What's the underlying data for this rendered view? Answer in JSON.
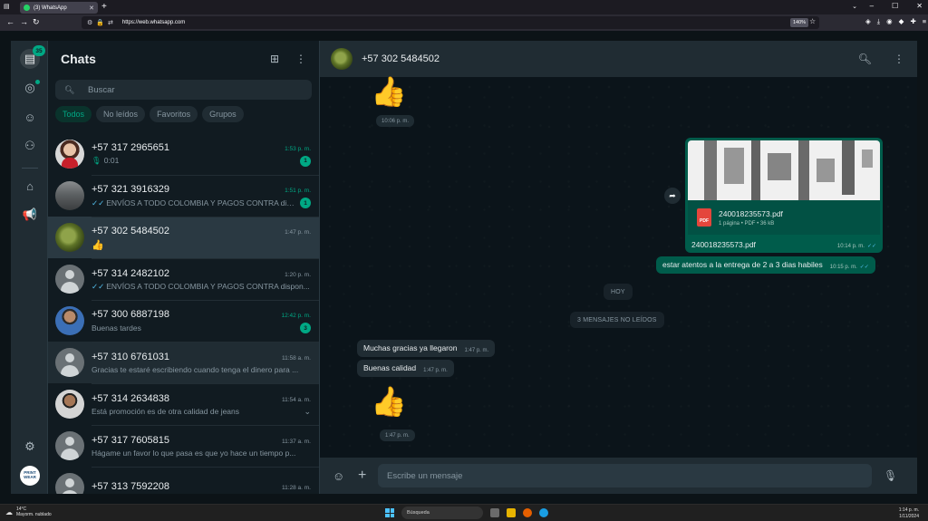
{
  "browser": {
    "tab_title": "(3) WhatsApp",
    "url": "https://web.whatsapp.com",
    "zoom": "140%"
  },
  "rail": {
    "chats_badge": "35",
    "avatar_text": "PRINT WEAR"
  },
  "sidebar": {
    "title": "Chats",
    "search_placeholder": "Buscar",
    "filters": [
      "Todos",
      "No leídos",
      "Favoritos",
      "Grupos"
    ],
    "chats": [
      {
        "name": "+57 317 2965651",
        "time": "1:53 p. m.",
        "preview": "0:01",
        "unread": "1"
      },
      {
        "name": "+57 321 3916329",
        "time": "1:51 p. m.",
        "preview": "ENVÍOS A TODO COLOMBIA Y PAGOS CONTRA dis...",
        "unread": "1"
      },
      {
        "name": "+57 302 5484502",
        "time": "1:47 p. m.",
        "preview": "👍"
      },
      {
        "name": "+57 314 2482102",
        "time": "1:20 p. m.",
        "preview": "ENVÍOS A TODO COLOMBIA Y PAGOS CONTRA dispon..."
      },
      {
        "name": "+57 300 6887198",
        "time": "12:42 p. m.",
        "preview": "Buenas tardes",
        "unread": "3"
      },
      {
        "name": "+57 310 6761031",
        "time": "11:58 a. m.",
        "preview": "Gracias te estaré escribiendo cuando tenga el dinero para ..."
      },
      {
        "name": "+57 314 2634838",
        "time": "11:54 a. m.",
        "preview": "Está promoción es de otra calidad de jeans"
      },
      {
        "name": "+57 317 7605815",
        "time": "11:37 a. m.",
        "preview": "Hágame un favor lo que pasa es que yo hace un tiempo p..."
      },
      {
        "name": "+57 313 7592208",
        "time": "11:28 a. m.",
        "preview": ""
      }
    ]
  },
  "conversation": {
    "contact_name": "+57 302 5484502",
    "emoji_top": "👍",
    "time_top": "10:06 p. m.",
    "document": {
      "file_name": "240018235573.pdf",
      "meta": "1 página • PDF • 36 kB",
      "pdf_label": "PDF",
      "caption": "240018235573.pdf",
      "time": "10:14 p. m."
    },
    "out_msg": {
      "text": "estar atentos a la entrega de 2 a 3 dias habiles",
      "time": "10:15 p. m."
    },
    "day_label": "HOY",
    "unread_label": "3 MENSAJES NO LEÍDOS",
    "in_msgs": [
      {
        "text": "Muchas gracias ya llegaron",
        "time": "1:47 p. m."
      },
      {
        "text": "Buenas calidad",
        "time": "1:47 p. m."
      }
    ],
    "emoji_bottom": "👍",
    "time_bottom": "1:47 p. m.",
    "composer_placeholder": "Escribe un mensaje"
  },
  "taskbar": {
    "weather_temp": "14°C",
    "weather_desc": "Mayorm. nublado",
    "search_label": "Búsqueda",
    "clock_time": "1:14 p. m.",
    "clock_date": "1/11/2024"
  },
  "colors": {
    "accent": "#00a884",
    "outgoing_bubble": "#005c4b",
    "incoming_bubble": "#202c33",
    "read_ticks": "#53bdeb"
  }
}
